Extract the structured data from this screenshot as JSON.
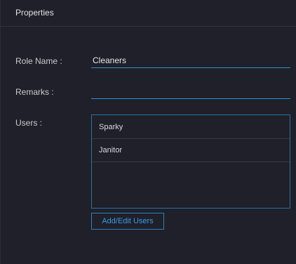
{
  "panel": {
    "title": "Properties"
  },
  "form": {
    "role_name": {
      "label": "Role Name :",
      "value": "Cleaners"
    },
    "remarks": {
      "label": "Remarks :",
      "value": ""
    },
    "users": {
      "label": "Users :",
      "items": [
        "Sparky",
        "Janitor"
      ]
    }
  },
  "actions": {
    "add_edit_users_label": "Add/Edit Users"
  },
  "colors": {
    "background": "#1f2029",
    "accent": "#2e8fd6",
    "button_text": "#3d9ae6"
  }
}
